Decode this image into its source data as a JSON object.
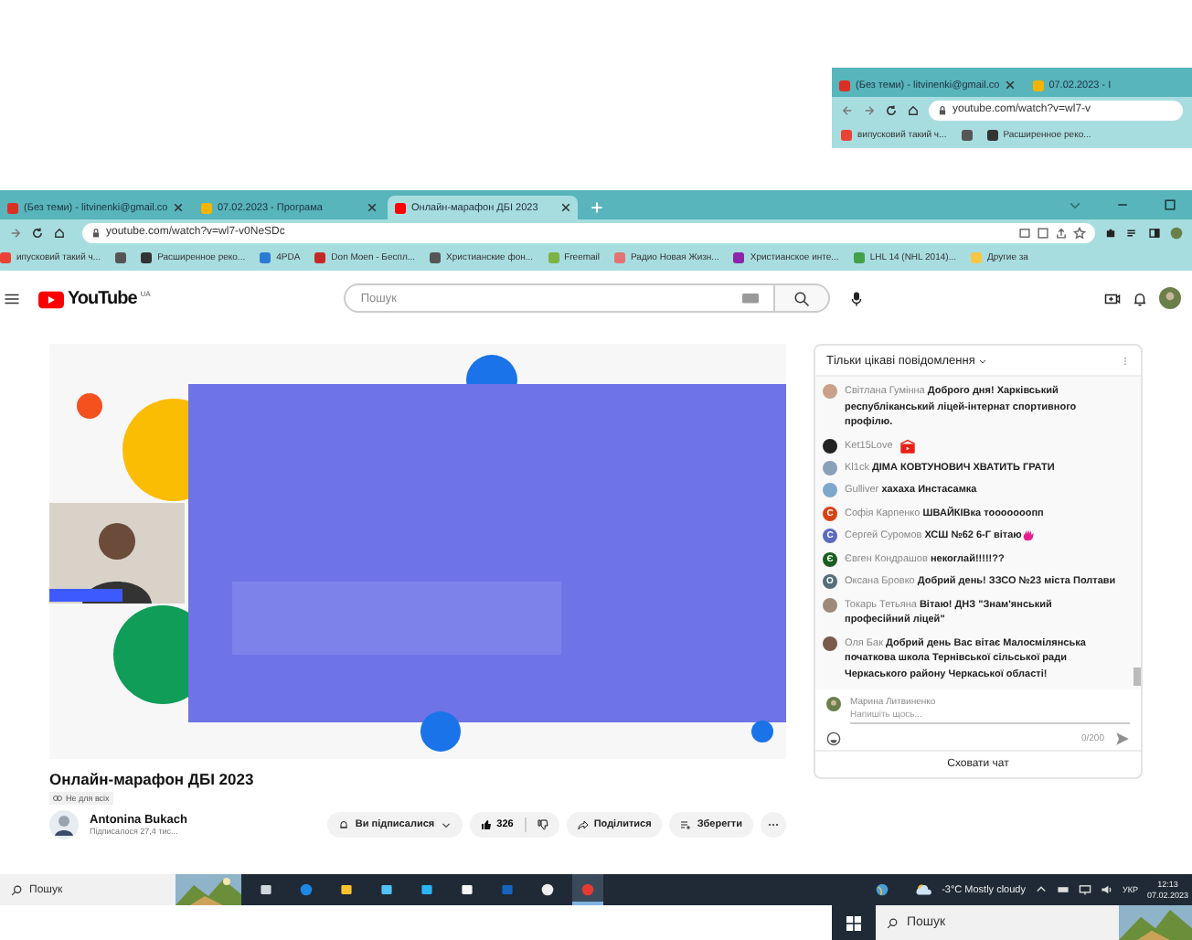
{
  "top_inset": {
    "tabs": [
      {
        "title": "(Без теми) - litvinenki@gmail.co",
        "color": "#d93025",
        "selected": false
      },
      {
        "title": "07.02.2023 - І",
        "color": "#f5b400",
        "selected": false
      }
    ],
    "address": "youtube.com/watch?v=wl7-v",
    "bookmarks": [
      {
        "label": "випусковий такий ч...",
        "color": "#ea4335"
      },
      {
        "color": "#555555"
      },
      {
        "label": "Расширенное реко...",
        "color": "#333333"
      }
    ]
  },
  "browser": {
    "tabs": [
      {
        "title": "(Без теми) - litvinenki@gmail.co",
        "color": "#d93025",
        "selected": false
      },
      {
        "title": "07.02.2023 - Програма",
        "color": "#f5b400",
        "selected": false
      },
      {
        "title": "Онлайн-марафон ДБІ 2023",
        "color": "#ff0000",
        "selected": true
      }
    ],
    "address": "youtube.com/watch?v=wl7-v0NeSDc",
    "bookmarks": [
      {
        "label": "ипусковий такий ч...",
        "color": "#ea4335"
      },
      {
        "color": "#555555"
      },
      {
        "label": "Расширенное реко...",
        "color": "#333333"
      },
      {
        "label": "4PDA",
        "color": "#2a7bd4"
      },
      {
        "label": "Don Moen - Беспл...",
        "color": "#c62828"
      },
      {
        "label": "Христианские фон...",
        "color": "#555555"
      },
      {
        "label": "Freemail",
        "color": "#7cb342"
      },
      {
        "label": "Радио Новая Жизн...",
        "color": "#e57373"
      },
      {
        "label": "Христианское инте...",
        "color": "#8e24aa"
      },
      {
        "label": "LHL 14 (NHL 2014)...",
        "color": "#43a047"
      },
      {
        "label": "Другие за",
        "color": "#f6c744"
      }
    ]
  },
  "youtube": {
    "logo": "YouTube",
    "region": "UA",
    "search": {
      "placeholder": "Пошук"
    }
  },
  "video": {
    "title": "Онлайн-марафон ДБІ 2023",
    "badge": "Не для всіх",
    "channel": {
      "name": "Antonina Bukach",
      "subscribers": "Підписалося 27,4 тис..."
    },
    "actions": {
      "subscribe": "Ви підписалися",
      "likes": "326",
      "share": "Поділитися",
      "save": "Зберегти"
    }
  },
  "chat": {
    "header": "Тільки цікаві повідомлення",
    "messages": [
      {
        "kind": "text",
        "author": "Світлана Гумінна",
        "text": "Доброго дня! Харківський республіканський ліцей-інтернат спортивного профілю.",
        "color": "#c9a08a"
      },
      {
        "kind": "sticker",
        "author": "Ket15Love",
        "color": "#222222"
      },
      {
        "kind": "text",
        "author": "Kl1ck",
        "text": "ДІМА КОВТУНОВИЧ ХВАТИТЬ ГРАТИ",
        "color": "#8aa0b8"
      },
      {
        "kind": "text",
        "author": "Gulliver",
        "text": "хахаха Инстасамка",
        "color": "#7fa7c9"
      },
      {
        "kind": "text",
        "author": "Софія Карпенко",
        "text": "ШВАЙКІВка тооооооопп",
        "color": "#d84315",
        "initial": "С"
      },
      {
        "kind": "wave",
        "author": "Сергей Суромов",
        "text": "ХСШ №62 6-Г вітаю",
        "color": "#5c6bc0",
        "initial": "С"
      },
      {
        "kind": "text",
        "author": "Євген Кондрашов",
        "text": "некоглай!!!!!??",
        "color": "#1b5e20",
        "initial": "Є"
      },
      {
        "kind": "text",
        "author": "Оксана Бровко",
        "text": "Добрий день! ЗЗСО №23 міста Полтави",
        "color": "#546e7a",
        "initial": "О"
      },
      {
        "kind": "text",
        "author": "Токарь Тетьяна",
        "text": "Вітаю! ДНЗ \"Знам'янський професійний ліцей\"",
        "color": "#9e8a7a"
      },
      {
        "kind": "text",
        "author": "Оля Бак",
        "text": "Добрий день Вас вітає Малосмілянська початкова школа Тернівської сільської ради Черкаського району Черкаської області!",
        "color": "#7a5a4a"
      }
    ],
    "composer": {
      "user": "Марина Литвиненко",
      "placeholder": "Напишіть щось...",
      "counter": "0/200"
    },
    "hide_button": "Сховати чат"
  },
  "taskbar": {
    "search": "Пошук",
    "apps": [
      {
        "kind": "taskview",
        "selected": false
      },
      {
        "kind": "edge",
        "selected": false
      },
      {
        "kind": "files",
        "selected": false
      },
      {
        "kind": "store",
        "selected": false
      },
      {
        "kind": "mail",
        "selected": false
      },
      {
        "kind": "amazon",
        "selected": false
      },
      {
        "kind": "dropbox",
        "selected": false
      },
      {
        "kind": "circle",
        "selected": false
      },
      {
        "kind": "chrome",
        "selected": true
      }
    ],
    "weather": "-3°C Mostly cloudy",
    "language": "УКР",
    "time": "12:13",
    "date": "07.02.2023"
  },
  "bottom_inset": {
    "search": "Пошук"
  }
}
